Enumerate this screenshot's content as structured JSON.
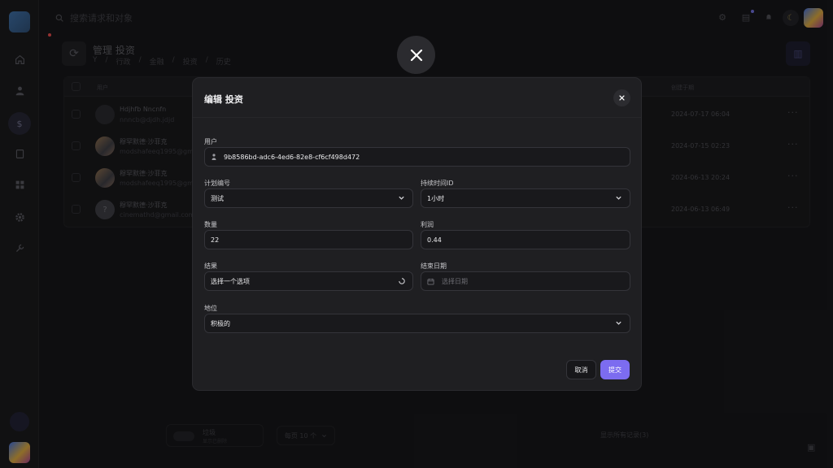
{
  "topbar": {
    "search_placeholder": "搜索请求和对象",
    "icons": [
      "gear-icon",
      "translate-icon",
      "bell-icon",
      "moon-icon"
    ]
  },
  "page": {
    "title": "管理 投资",
    "breadcrumb": [
      "Y",
      "行政",
      "金融",
      "投资",
      "历史"
    ]
  },
  "table": {
    "headers": {
      "user": "用户",
      "date": "创建于期"
    },
    "rows": [
      {
        "name": "Hdjhfb Nncnfn",
        "email": "nnncb@djdh.jdjd",
        "date": "2024-07-17 06:04"
      },
      {
        "name": "穆罕默德·沙菲克",
        "email": "modshafeeq1995@gmail",
        "date": "2024-07-15 02:23"
      },
      {
        "name": "穆罕默德·沙菲克",
        "email": "modshafeeq1995@gmail",
        "date": "2024-06-13 20:24"
      },
      {
        "name": "穆罕默德·沙菲克",
        "email": "cinemathd@gmail.com",
        "date": "2024-06-13 06:49"
      }
    ],
    "more": "···"
  },
  "footer": {
    "toggle_label": "垃圾",
    "toggle_sub": "显示已删除",
    "per_page": "每页 10 个",
    "count": "显示所有记录(3)"
  },
  "modal": {
    "title": "编辑 投资",
    "fields": {
      "user": {
        "label": "用户",
        "value": "9b8586bd-adc6-4ed6-82e8-cf6cf498d472"
      },
      "plan": {
        "label": "计划编号",
        "value": "测试"
      },
      "duration": {
        "label": "持续时间ID",
        "value": "1小时"
      },
      "amount": {
        "label": "数量",
        "value": "22"
      },
      "profit": {
        "label": "利润",
        "value": "0.44"
      },
      "result": {
        "label": "结果",
        "value": "选择一个选项"
      },
      "end_date": {
        "label": "结束日期",
        "placeholder": "选择日期"
      },
      "status": {
        "label": "地位",
        "value": "积极的"
      }
    },
    "cancel_label": "取消",
    "submit_label": "提交",
    "accent": "#7c6cf0"
  }
}
